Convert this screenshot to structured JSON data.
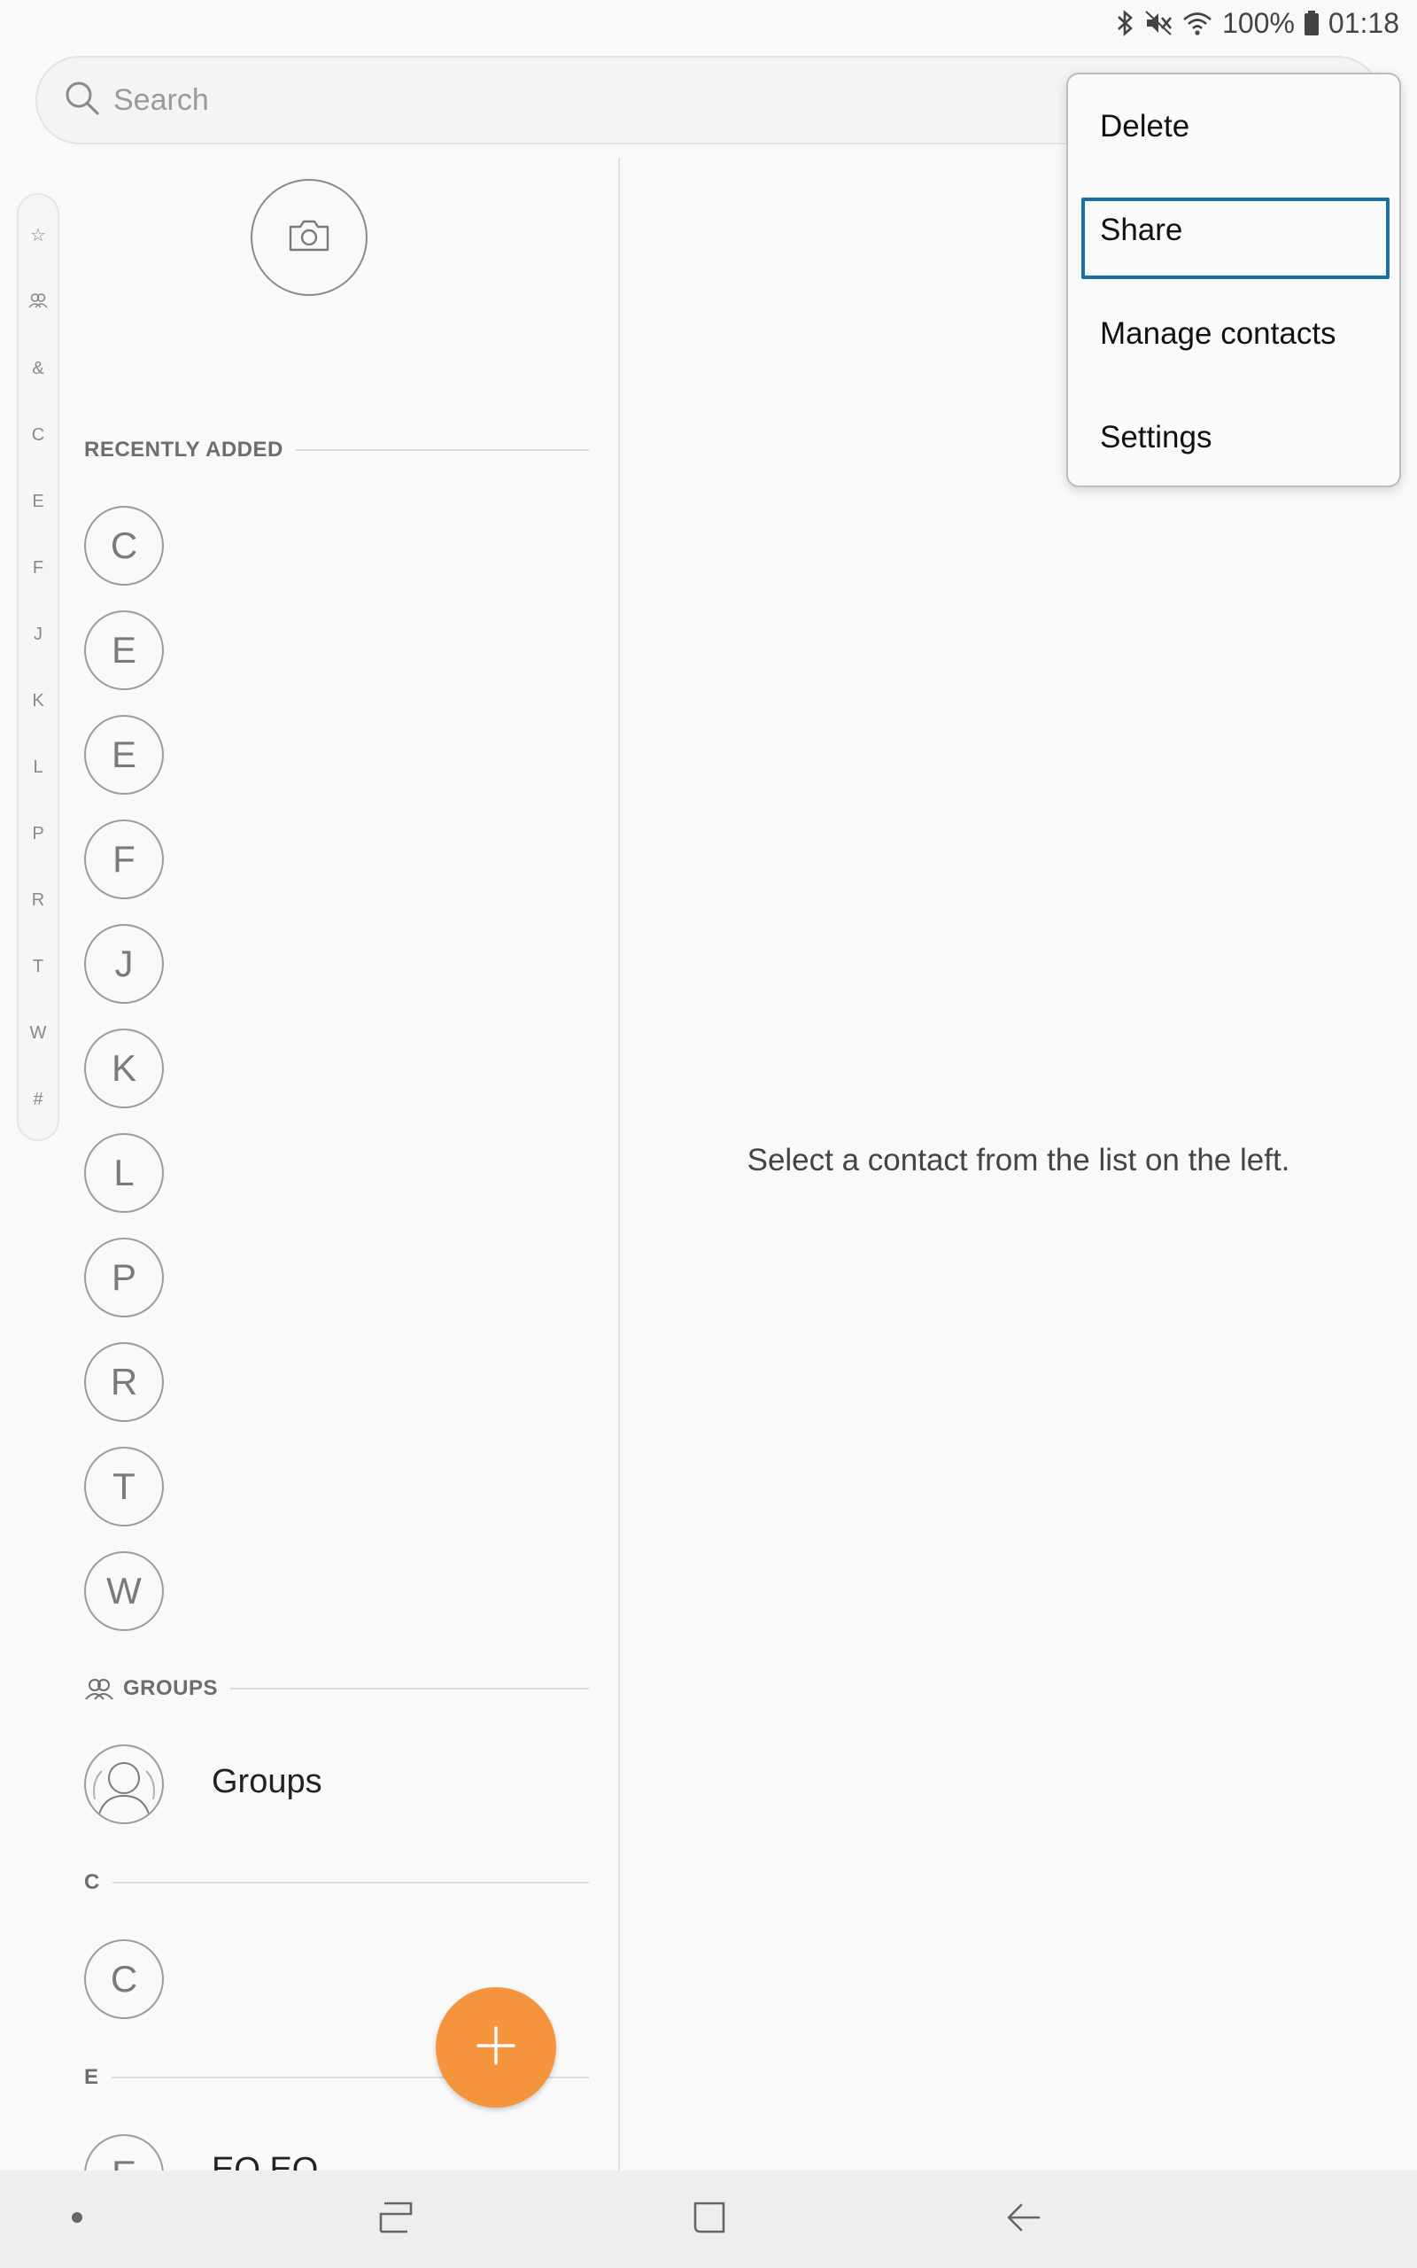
{
  "status_bar": {
    "battery": "100%",
    "time": "01:18",
    "icons": [
      "bluetooth-icon",
      "mute-icon",
      "wifi-icon",
      "battery-icon"
    ]
  },
  "search": {
    "placeholder": "Search",
    "icon": "search-icon"
  },
  "index_strip": [
    "☆",
    "group",
    "&",
    "C",
    "E",
    "F",
    "J",
    "K",
    "L",
    "P",
    "R",
    "T",
    "W",
    "#"
  ],
  "profile": {
    "icon": "camera-icon"
  },
  "recently_added": {
    "header": "RECENTLY ADDED",
    "items": [
      "C",
      "E",
      "E",
      "F",
      "J",
      "K",
      "L",
      "P",
      "R",
      "T",
      "W"
    ]
  },
  "groups_section": {
    "header": "GROUPS",
    "icon": "groups-icon",
    "row_label": "Groups"
  },
  "sections": [
    {
      "header": "C",
      "avatar": "C"
    },
    {
      "header": "E",
      "avatar": "E",
      "row_label": "EQ EQ"
    }
  ],
  "fab": {
    "icon": "plus-icon"
  },
  "detail_pane": {
    "message": "Select a contact from the list on the left."
  },
  "menu": {
    "items": [
      "Delete",
      "Share",
      "Manage contacts",
      "Settings"
    ],
    "focused": "Share"
  },
  "nav_bar": {
    "buttons": [
      "dot-icon",
      "recents-icon",
      "home-icon",
      "back-icon"
    ]
  },
  "colors": {
    "accent": "#f6943e",
    "focus_border": "#1a6fa8",
    "background": "#f9f9f9"
  }
}
